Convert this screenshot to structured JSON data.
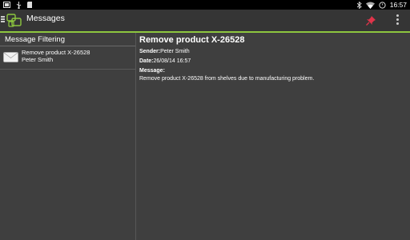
{
  "status_bar": {
    "time": "16:57",
    "left_icons": [
      "screenshot-icon",
      "usb-icon",
      "sd-card-icon"
    ],
    "right_icons": [
      "bluetooth-icon",
      "wifi-icon",
      "alarm-icon"
    ]
  },
  "action_bar": {
    "title": "Messages",
    "accent_color": "#8dc63f",
    "actions": [
      "pin-icon",
      "overflow-menu-icon"
    ]
  },
  "left_pane": {
    "header": "Message Filtering",
    "items": [
      {
        "subject": "Remove product X-26528",
        "sender": "Peter Smith",
        "icon": "envelope-icon"
      }
    ]
  },
  "detail": {
    "title": "Remove product X-26528",
    "sender_label": "Sender:",
    "sender_value": "Peter Smith",
    "date_label": "Date:",
    "date_value": "26/08/14 16:57",
    "message_label": "Message:",
    "message_body": "Remove product X-26528 from shelves due to manufacturing problem."
  }
}
